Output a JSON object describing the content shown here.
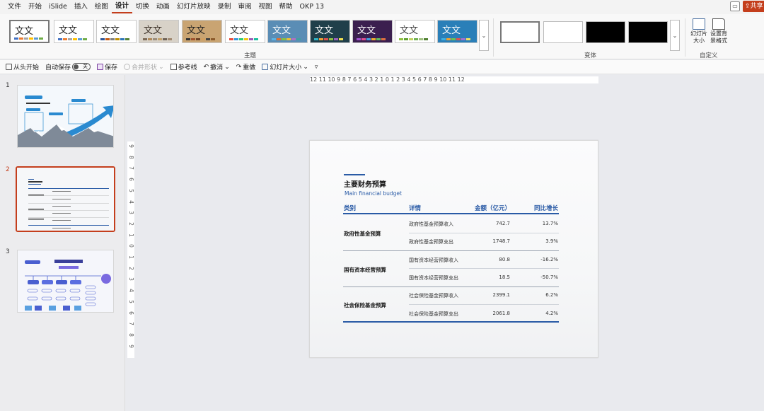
{
  "menubar": {
    "items": [
      "文件",
      "开始",
      "iSlide",
      "插入",
      "绘图",
      "设计",
      "切换",
      "动画",
      "幻灯片放映",
      "录制",
      "审阅",
      "视图",
      "帮助",
      "OKP 13"
    ],
    "active": "设计",
    "share_label": "共享"
  },
  "ribbon": {
    "themes": [
      {
        "label": "文文",
        "bg": "#ffffff",
        "fg": "#222222",
        "bars": [
          "#4472c4",
          "#ed7d31",
          "#a5a5a5",
          "#ffc000",
          "#5b9bd5",
          "#70ad47"
        ]
      },
      {
        "label": "文文",
        "bg": "#ffffff",
        "fg": "#222222",
        "bars": [
          "#4472c4",
          "#ed7d31",
          "#a5a5a5",
          "#ffc000",
          "#5b9bd5",
          "#70ad47"
        ]
      },
      {
        "label": "文文",
        "bg": "#ffffff",
        "fg": "#222222",
        "bars": [
          "#2f5597",
          "#c55a11",
          "#7f7f7f",
          "#bf9000",
          "#2e75b6",
          "#548235"
        ]
      },
      {
        "label": "文文",
        "bg": "#d8d2c8",
        "fg": "#3a2f25",
        "bars": [
          "#7b6a58",
          "#b08a5a",
          "#9a8c7a",
          "#c3a26b",
          "#6e6255",
          "#a08870"
        ]
      },
      {
        "label": "文文",
        "bg": "#c9a472",
        "fg": "#222222",
        "bars": [
          "#333333",
          "#a0522d",
          "#6b4226",
          "#d2a060",
          "#444444",
          "#8b5a2b"
        ]
      },
      {
        "label": "文文",
        "bg": "#ffffff",
        "fg": "#333333",
        "bars": [
          "#e74c3c",
          "#3498db",
          "#2ecc71",
          "#f1c40f",
          "#9b59b6",
          "#1abc9c"
        ]
      },
      {
        "label": "文文",
        "bg": "#5a8db5",
        "fg": "#ffffff",
        "bars": [
          "#5ab4e5",
          "#e07030",
          "#88c040",
          "#f0c030",
          "#b070c0",
          "#40a0a0"
        ]
      },
      {
        "label": "文文",
        "bg": "#1f3f4a",
        "fg": "#ffffff",
        "bars": [
          "#2fb5c5",
          "#f0a030",
          "#e05050",
          "#90c040",
          "#a060c0",
          "#f0e050"
        ]
      },
      {
        "label": "文文",
        "bg": "#3b1f4f",
        "fg": "#ffffff",
        "bars": [
          "#a050d0",
          "#e05090",
          "#40a0e0",
          "#f0b030",
          "#60c060",
          "#e07040"
        ]
      },
      {
        "label": "文文",
        "bg": "#ffffff",
        "fg": "#444444",
        "bars": [
          "#90c040",
          "#60a030",
          "#c0d060",
          "#70b050",
          "#a0c080",
          "#508030"
        ]
      },
      {
        "label": "文文",
        "bg": "#2a7fb8",
        "fg": "#ffffff",
        "bars": [
          "#40b0e0",
          "#f0a030",
          "#70c050",
          "#e05050",
          "#a070d0",
          "#f0e060"
        ]
      }
    ],
    "variants": [
      {
        "bg": "#ffffff"
      },
      {
        "bg": "#ffffff"
      },
      {
        "bg": "#000000"
      },
      {
        "bg": "#000000"
      }
    ],
    "group_theme": "主题",
    "group_variant": "变体",
    "group_custom": "自定义",
    "slide_size_label": "幻灯片大小",
    "bg_format_label": "设置背景格式"
  },
  "qat": {
    "from_start": "从头开始",
    "autosave": "自动保存",
    "autosave_state": "关",
    "save": "保存",
    "merge_shapes": "合并形状",
    "guides": "参考线",
    "undo": "撤消",
    "redo": "重做",
    "slide_size": "幻灯片大小"
  },
  "thumbnails": [
    {
      "num": "1",
      "current": false
    },
    {
      "num": "2",
      "current": true
    },
    {
      "num": "3",
      "current": false
    }
  ],
  "ruler": {
    "horizontal": "12 11 10 9 8 7 6 5 4 3 2 1 0 1 2 3 4 5 6 7 8 9 10 11 12",
    "vertical": [
      "9",
      "8",
      "7",
      "6",
      "5",
      "4",
      "3",
      "2",
      "1",
      "0",
      "1",
      "2",
      "3",
      "4",
      "5",
      "6",
      "7",
      "8",
      "9"
    ]
  },
  "slide": {
    "title": "主要财务预算",
    "subtitle": "Main financial budget",
    "headers": {
      "category": "类别",
      "detail": "详情",
      "amount": "金额（亿元）",
      "growth": "同比增长"
    },
    "groups": [
      {
        "category": "政府性基金预算",
        "rows": [
          {
            "detail": "政府性基金预算收入",
            "amount": "742.7",
            "growth": "13.7%"
          },
          {
            "detail": "政府性基金预算支出",
            "amount": "1748.7",
            "growth": "3.9%"
          }
        ]
      },
      {
        "category": "国有资本经营预算",
        "rows": [
          {
            "detail": "国有资本经营预算收入",
            "amount": "80.8",
            "growth": "-16.2%"
          },
          {
            "detail": "国有资本经营预算支出",
            "amount": "18.5",
            "growth": "-50.7%"
          }
        ]
      },
      {
        "category": "社会保险基金预算",
        "rows": [
          {
            "detail": "社会保险基金预算收入",
            "amount": "2399.1",
            "growth": "6.2%"
          },
          {
            "detail": "社会保险基金预算支出",
            "amount": "2061.8",
            "growth": "4.2%"
          }
        ]
      }
    ]
  }
}
